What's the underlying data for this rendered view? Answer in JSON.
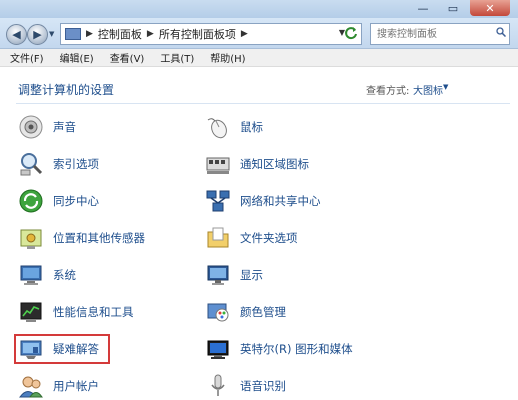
{
  "window": {
    "controls": {
      "minimize": "—",
      "maximize": "▭",
      "close": "✕"
    }
  },
  "address": {
    "back_glyph": "◀",
    "forward_glyph": "▶",
    "crumbs": [
      "控制面板",
      "所有控制面板项"
    ],
    "search_placeholder": "搜索控制面板"
  },
  "menu": {
    "items": [
      "文件(F)",
      "编辑(E)",
      "查看(V)",
      "工具(T)",
      "帮助(H)"
    ]
  },
  "content": {
    "title": "调整计算机的设置",
    "viewmode_label": "查看方式:",
    "viewmode_value": "大图标",
    "left_items": [
      "声音",
      "索引选项",
      "同步中心",
      "位置和其他传感器",
      "系统",
      "性能信息和工具",
      "疑难解答",
      "用户帐户"
    ],
    "right_items": [
      "鼠标",
      "通知区域图标",
      "网络和共享中心",
      "文件夹选项",
      "显示",
      "颜色管理",
      "英特尔(R) 图形和媒体",
      "语音识别"
    ],
    "icons": {
      "left": [
        "speaker-icon",
        "index-magnifier-icon",
        "sync-center-icon",
        "location-sensor-icon",
        "system-monitor-icon",
        "performance-chart-icon",
        "troubleshooting-icon",
        "user-accounts-icon"
      ],
      "right": [
        "mouse-icon",
        "notification-tray-icon",
        "network-sharing-icon",
        "folder-options-icon",
        "display-icon",
        "color-management-icon",
        "intel-graphics-icon",
        "microphone-icon"
      ]
    }
  }
}
